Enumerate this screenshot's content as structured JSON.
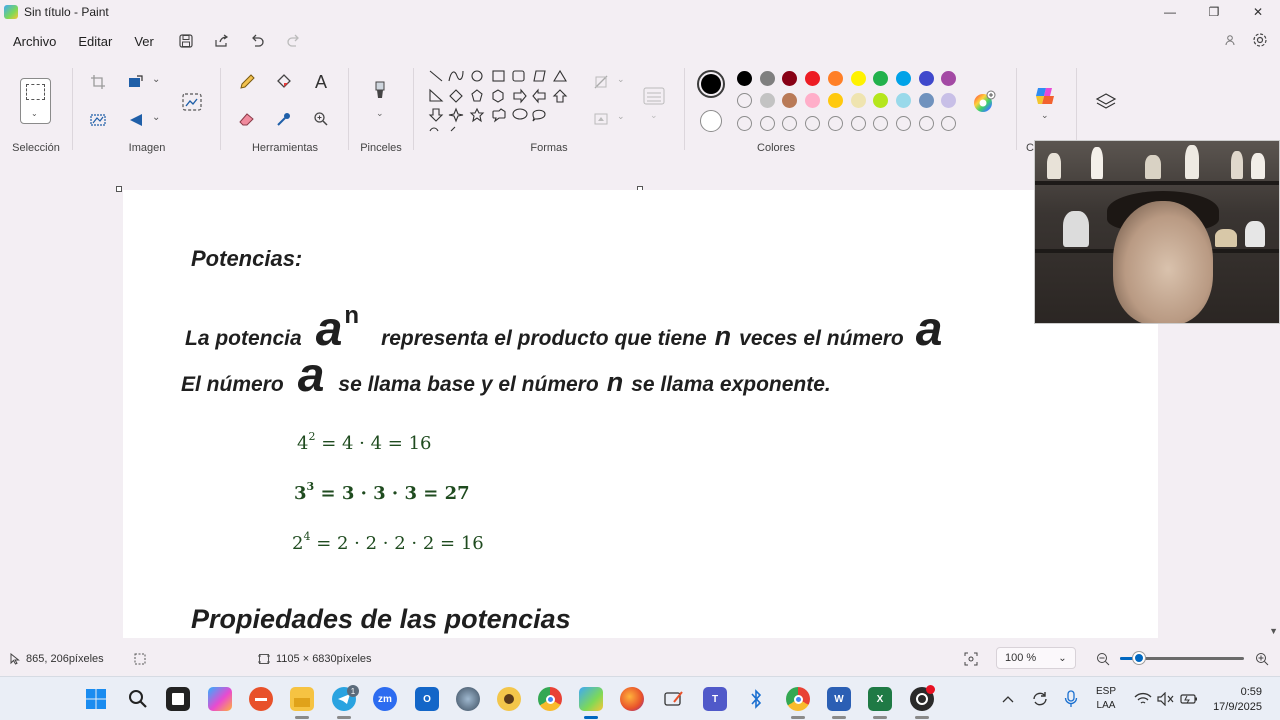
{
  "window": {
    "title": "Sin título - Paint",
    "controls": [
      "—",
      "❐",
      "✕"
    ]
  },
  "menu": {
    "file": "Archivo",
    "edit": "Editar",
    "view": "Ver"
  },
  "ribbon": {
    "groups": {
      "selection": "Selección",
      "image": "Imagen",
      "tools": "Herramientas",
      "brushes": "Pinceles",
      "shapes": "Formas",
      "colors": "Colores",
      "creative_truncated": "C"
    },
    "primary_color": "#000000",
    "secondary_color": "#ffffff",
    "palette_row1": [
      "#000000",
      "#7f7f7f",
      "#880015",
      "#ed1c24",
      "#ff7f27",
      "#fff200",
      "#22b14c",
      "#00a2e8",
      "#3f48cc",
      "#a349a4"
    ],
    "palette_row2": [
      "",
      "#c3c3c3",
      "#b97a57",
      "#ffaec9",
      "#ffc90e",
      "#efe4b0",
      "#b5e61d",
      "#99d9ea",
      "#7092be",
      "#c8bfe7"
    ],
    "palette_row3_custom_slots": 10
  },
  "document": {
    "title": "Potencias:",
    "line1": {
      "t1": "La potencia",
      "sym_base": "a",
      "sym_exp": "n",
      "t2": "representa el producto que tiene",
      "sym_n": "n",
      "t3": "veces el número",
      "sym_a": "a"
    },
    "line2": {
      "t1": "El número",
      "sym_a": "a",
      "t2": "se llama base y el número",
      "sym_n": "n",
      "t3": "se llama exponente."
    },
    "equations": [
      {
        "base": "4",
        "exp": "2",
        "rhs": "= 4 · 4 = 16"
      },
      {
        "base": "3",
        "exp": "3",
        "rhs": "= 3 · 3 · 3 = 27"
      },
      {
        "base": "2",
        "exp": "4",
        "rhs": "= 2 · 2 · 2 · 2 = 16"
      }
    ],
    "section_title": "Propiedades de las potencias"
  },
  "status": {
    "cursor_pos": "865, 206píxeles",
    "canvas_size": "1105 × 6830píxeles",
    "zoom": "100 %",
    "zoom_level_fraction": 0.15
  },
  "taskbar": {
    "lang_line1": "ESP",
    "lang_line2": "LAA",
    "time": "0:59",
    "date": "17/9/2025",
    "telegram_badge": "1",
    "zoom_label": "zm"
  }
}
